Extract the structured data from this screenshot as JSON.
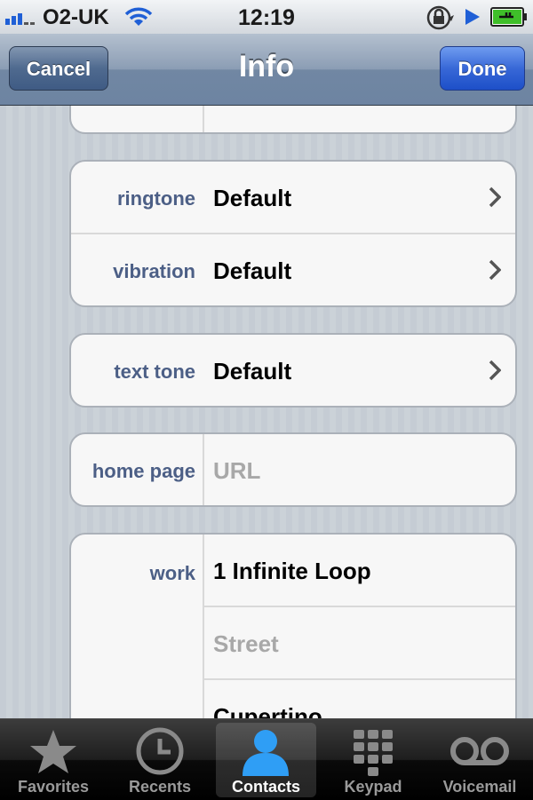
{
  "status": {
    "carrier": "O2-UK",
    "time": "12:19"
  },
  "nav": {
    "title": "Info",
    "cancel_label": "Cancel",
    "done_label": "Done"
  },
  "tones": [
    {
      "label": "ringtone",
      "value": "Default"
    },
    {
      "label": "vibration",
      "value": "Default"
    }
  ],
  "text_tone": {
    "label": "text tone",
    "value": "Default"
  },
  "home_page": {
    "label": "home page",
    "placeholder": "URL"
  },
  "address": {
    "label": "work",
    "line1": "1 Infinite Loop",
    "street_placeholder": "Street",
    "city": "Cupertino"
  },
  "tabs": [
    {
      "label": "Favorites",
      "icon": "star-icon"
    },
    {
      "label": "Recents",
      "icon": "clock-icon"
    },
    {
      "label": "Contacts",
      "icon": "person-icon",
      "active": true
    },
    {
      "label": "Keypad",
      "icon": "keypad-icon"
    },
    {
      "label": "Voicemail",
      "icon": "voicemail-icon"
    }
  ],
  "colors": {
    "label": "#4c5f86",
    "done": "#2a5cd0",
    "nav": "#6d84a2"
  }
}
